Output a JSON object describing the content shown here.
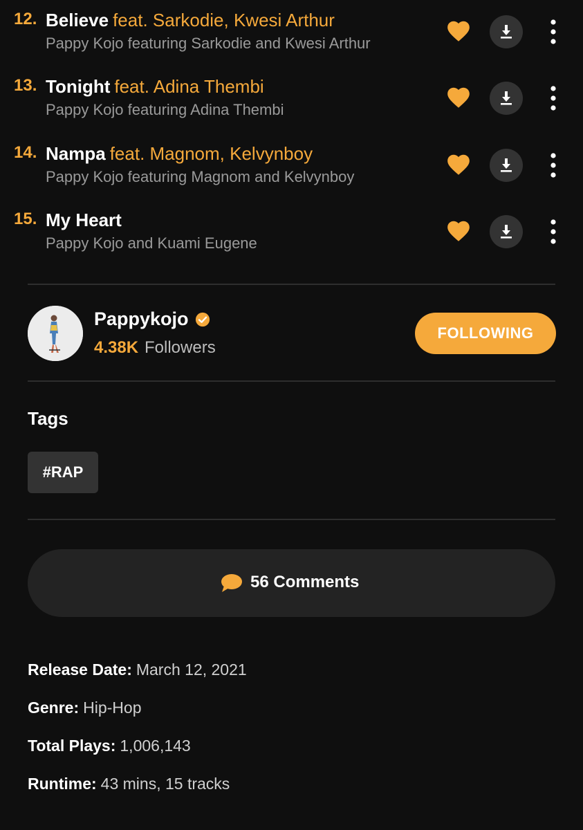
{
  "tracks": [
    {
      "number": "12.",
      "title": "Believe",
      "feat": "feat. Sarkodie, Kwesi Arthur",
      "artist_line": "Pappy Kojo featuring Sarkodie and Kwesi Arthur"
    },
    {
      "number": "13.",
      "title": "Tonight",
      "feat": "feat. Adina Thembi",
      "artist_line": "Pappy Kojo featuring Adina Thembi"
    },
    {
      "number": "14.",
      "title": "Nampa",
      "feat": "feat. Magnom, Kelvynboy",
      "artist_line": "Pappy Kojo featuring Magnom and Kelvynboy"
    },
    {
      "number": "15.",
      "title": "My Heart",
      "feat": "",
      "artist_line": "Pappy Kojo and Kuami Eugene"
    }
  ],
  "artist": {
    "name": "Pappykojo",
    "verified": true,
    "followers_count": "4.38K",
    "followers_label": "Followers",
    "follow_button_label": "FOLLOWING"
  },
  "tags": {
    "heading": "Tags",
    "items": [
      "#RAP"
    ]
  },
  "comments": {
    "label": "56 Comments",
    "icon": "speech-bubble-icon"
  },
  "details": {
    "release_date_label": "Release Date:",
    "release_date_value": "March 12, 2021",
    "genre_label": "Genre:",
    "genre_value": "Hip-Hop",
    "total_plays_label": "Total Plays:",
    "total_plays_value": "1,006,143",
    "runtime_label": "Runtime:",
    "runtime_value": "43 mins, 15 tracks"
  },
  "colors": {
    "accent": "#f5a93b",
    "background": "#0f0f0f",
    "button_dark": "#333333",
    "comments_bg": "#232323",
    "muted_text": "#9a9a9a"
  }
}
